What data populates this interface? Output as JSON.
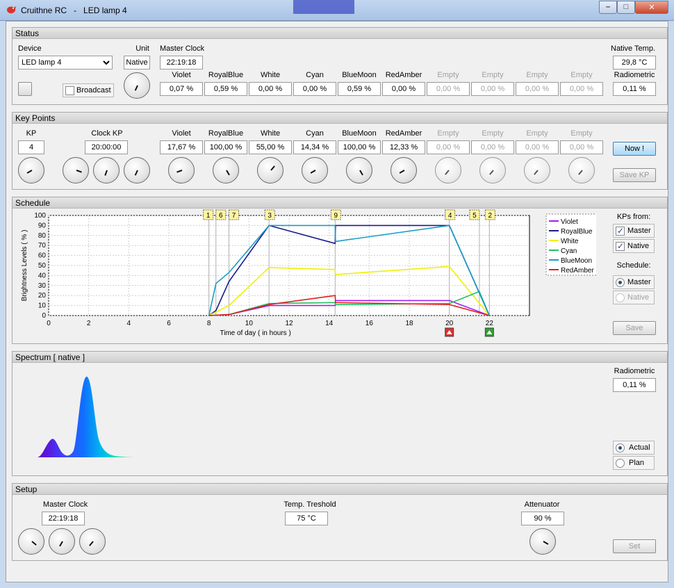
{
  "window": {
    "title": "Cruithne RC   -   LED lamp 4"
  },
  "status": {
    "header": "Status",
    "device_label": "Device",
    "device_value": "LED lamp 4",
    "unit_label": "Unit",
    "unit_value": "Native",
    "master_clock_label": "Master Clock",
    "master_clock_value": "22:19:18",
    "broadcast_label": "Broadcast",
    "native_temp_label": "Native  Temp.",
    "native_temp_value": "29,8 °C",
    "radiometric_label": "Radiometric",
    "radiometric_value": "0,11 %",
    "channels": [
      {
        "name": "Violet",
        "value": "0,07 %",
        "enabled": true
      },
      {
        "name": "RoyalBlue",
        "value": "0,59 %",
        "enabled": true
      },
      {
        "name": "White",
        "value": "0,00 %",
        "enabled": true
      },
      {
        "name": "Cyan",
        "value": "0,00 %",
        "enabled": true
      },
      {
        "name": "BlueMoon",
        "value": "0,59 %",
        "enabled": true
      },
      {
        "name": "RedAmber",
        "value": "0,00 %",
        "enabled": true
      },
      {
        "name": "Empty",
        "value": "0,00 %",
        "enabled": false
      },
      {
        "name": "Empty",
        "value": "0,00 %",
        "enabled": false
      },
      {
        "name": "Empty",
        "value": "0,00 %",
        "enabled": false
      },
      {
        "name": "Empty",
        "value": "0,00 %",
        "enabled": false
      }
    ]
  },
  "keypoints": {
    "header": "Key Points",
    "kp_label": "KP",
    "kp_value": "4",
    "clock_kp_label": "Clock   KP",
    "clock_kp_value": "20:00:00",
    "now_button": "Now !",
    "save_kp_button": "Save  KP",
    "channels": [
      {
        "name": "Violet",
        "value": "17,67 %",
        "enabled": true
      },
      {
        "name": "RoyalBlue",
        "value": "100,00 %",
        "enabled": true
      },
      {
        "name": "White",
        "value": "55,00 %",
        "enabled": true
      },
      {
        "name": "Cyan",
        "value": "14,34 %",
        "enabled": true
      },
      {
        "name": "BlueMoon",
        "value": "100,00 %",
        "enabled": true
      },
      {
        "name": "RedAmber",
        "value": "12,33 %",
        "enabled": true
      },
      {
        "name": "Empty",
        "value": "0,00 %",
        "enabled": false
      },
      {
        "name": "Empty",
        "value": "0,00 %",
        "enabled": false
      },
      {
        "name": "Empty",
        "value": "0,00 %",
        "enabled": false
      },
      {
        "name": "Empty",
        "value": "0,00 %",
        "enabled": false
      }
    ]
  },
  "schedule": {
    "header": "Schedule",
    "kps_from_label": "KPs from:",
    "master_check": "Master",
    "native_check": "Native",
    "schedule_label": "Schedule:",
    "master_radio": "Master",
    "native_radio": "Native",
    "save_button": "Save",
    "chart_data": {
      "type": "line",
      "xlabel": "Time of day  ( in hours )",
      "ylabel": "Brightness Levels  ( % )",
      "xlim": [
        0,
        24
      ],
      "ylim": [
        0,
        100
      ],
      "x_ticks": [
        0,
        2,
        4,
        6,
        8,
        10,
        12,
        14,
        16,
        18,
        20,
        22
      ],
      "y_ticks": [
        0,
        10,
        20,
        30,
        40,
        50,
        60,
        70,
        80,
        90,
        100
      ],
      "grid": true,
      "legend_position": "right",
      "keypoint_markers": [
        {
          "label": "1",
          "x": 8.0
        },
        {
          "label": "6",
          "x": 8.35
        },
        {
          "label": "7",
          "x": 9.0
        },
        {
          "label": "3",
          "x": 11.0
        },
        {
          "label": "9",
          "x": 14.3
        },
        {
          "label": "4",
          "x": 20.0
        },
        {
          "label": "5",
          "x": 21.5
        },
        {
          "label": "2",
          "x": 22.0
        }
      ],
      "series": [
        {
          "name": "Violet",
          "color": "#a020f0",
          "x": [
            8.0,
            9.0,
            11.0,
            14.3,
            14.32,
            20.0,
            22.0
          ],
          "y": [
            0,
            1,
            10,
            10,
            15,
            15,
            0
          ]
        },
        {
          "name": "RoyalBlue",
          "color": "#1a1a8c",
          "x": [
            8.0,
            8.35,
            9.0,
            11.0,
            14.3,
            14.32,
            20.0,
            22.0
          ],
          "y": [
            0,
            5,
            34,
            90,
            72,
            90,
            90,
            0
          ]
        },
        {
          "name": "White",
          "color": "#f0f000",
          "x": [
            8.0,
            9.0,
            11.0,
            14.3,
            14.32,
            20.0,
            22.0
          ],
          "y": [
            0,
            10,
            48,
            46,
            41,
            49,
            0
          ]
        },
        {
          "name": "Cyan",
          "color": "#20c060",
          "x": [
            8.0,
            9.0,
            11.0,
            14.3,
            14.32,
            20.0,
            21.5,
            22.0
          ],
          "y": [
            0,
            1,
            12,
            13,
            11,
            12,
            24,
            0
          ]
        },
        {
          "name": "BlueMoon",
          "color": "#1a9cc8",
          "x": [
            8.0,
            8.35,
            9.0,
            11.0,
            14.3,
            14.32,
            20.0,
            22.0
          ],
          "y": [
            0,
            32,
            43,
            90,
            90,
            74,
            90,
            0
          ]
        },
        {
          "name": "RedAmber",
          "color": "#e02020",
          "x": [
            8.0,
            9.0,
            11.0,
            14.3,
            14.32,
            20.0,
            22.0
          ],
          "y": [
            0,
            1,
            11,
            20,
            13,
            11,
            0
          ]
        }
      ],
      "sun_markers": [
        {
          "kind": "sunset",
          "x": 20.0,
          "color": "#e03030"
        },
        {
          "kind": "night",
          "x": 22.0,
          "color": "#2ea02e"
        }
      ]
    }
  },
  "spectrum": {
    "header": "Spectrum  [ native ]",
    "radiometric_label": "Radiometric",
    "radiometric_value": "0,11 %",
    "actual_radio": "Actual",
    "plan_radio": "Plan"
  },
  "setup": {
    "header": "Setup",
    "master_clock_label": "Master Clock",
    "master_clock_value": "22:19:18",
    "temp_threshold_label": "Temp. Treshold",
    "temp_threshold_value": "75 °C",
    "attenuator_label": "Attenuator",
    "attenuator_value": "90 %",
    "set_button": "Set"
  }
}
